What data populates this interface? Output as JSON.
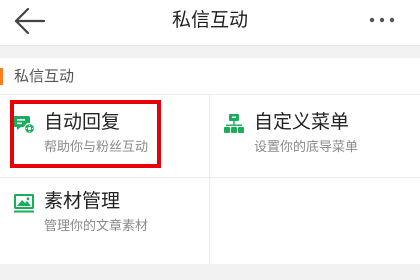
{
  "header": {
    "title": "私信互动",
    "back_icon": "arrow-left-icon",
    "more_icon": "more-dots-icon"
  },
  "section": {
    "title": "私信互动",
    "accent_color": "#ff7d1a"
  },
  "tiles": [
    {
      "label": "自动回复",
      "desc": "帮助你与粉丝互动",
      "icon": "auto-reply-icon",
      "icon_color": "#1aad5c"
    },
    {
      "label": "自定义菜单",
      "desc": "设置你的底导菜单",
      "icon": "custom-menu-icon",
      "icon_color": "#1aad5c"
    },
    {
      "label": "素材管理",
      "desc": "管理你的文章素材",
      "icon": "material-icon",
      "icon_color": "#1aad5c"
    }
  ],
  "highlight": {
    "target": "自动回复",
    "color": "#e8000b"
  }
}
